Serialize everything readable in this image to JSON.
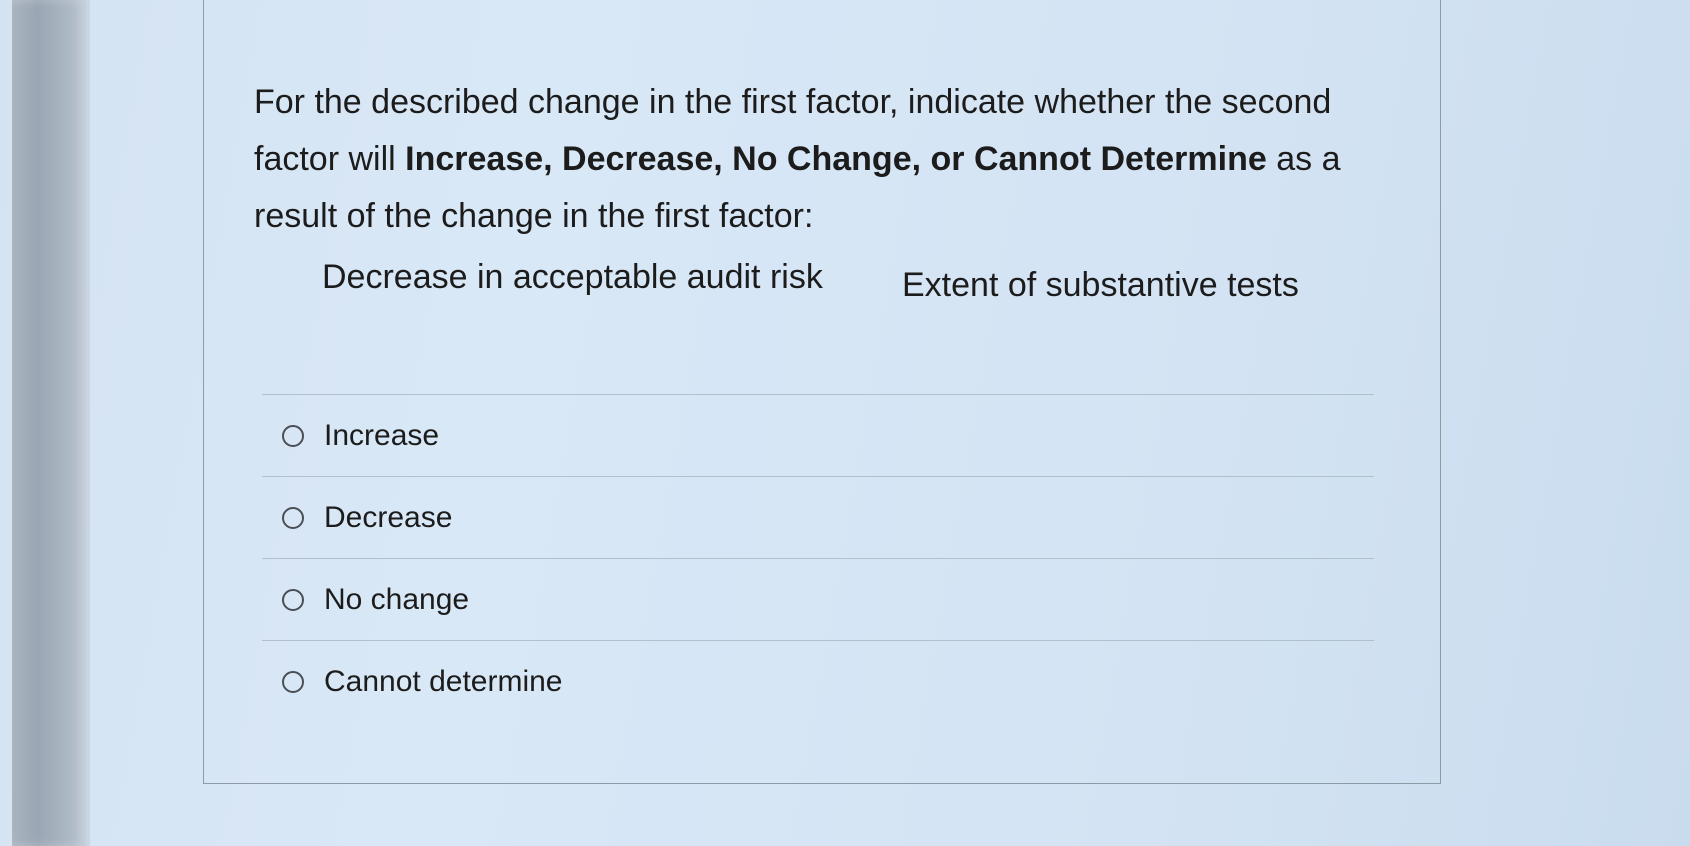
{
  "question": {
    "prompt_part1": "For the described change in the first factor, indicate whether the second factor will ",
    "prompt_bold": "Increase, Decrease, No Change, or Cannot Determine",
    "prompt_part2": " as a result of the change in the first factor:",
    "first_factor": "Decrease in acceptable audit risk",
    "second_factor": "Extent of substantive tests"
  },
  "options": [
    {
      "label": "Increase",
      "selected": false
    },
    {
      "label": "Decrease",
      "selected": false
    },
    {
      "label": "No change",
      "selected": false
    },
    {
      "label": "Cannot determine",
      "selected": false
    }
  ]
}
